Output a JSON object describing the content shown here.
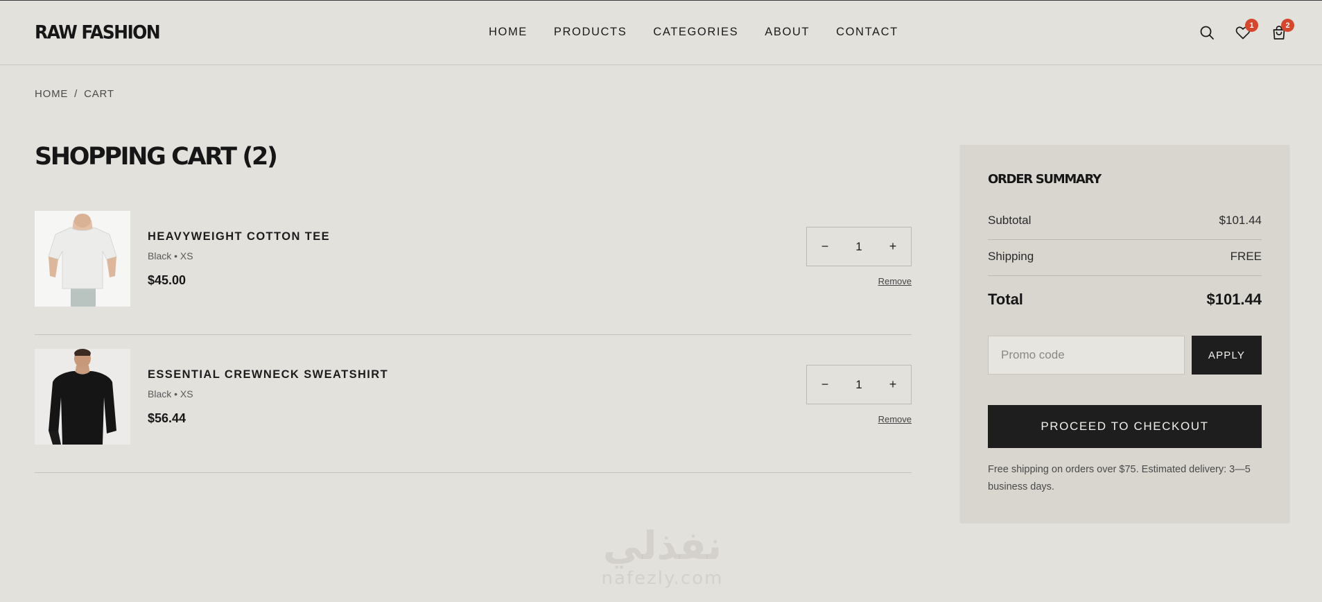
{
  "header": {
    "logo": "RAW FASHION",
    "nav": [
      "HOME",
      "PRODUCTS",
      "CATEGORIES",
      "ABOUT",
      "CONTACT"
    ],
    "icons": {
      "search": "search-icon",
      "wishlist": "heart-icon",
      "cart": "shopping-bag-icon"
    },
    "wishlist_count": "1",
    "cart_count": "2",
    "badge_color": "#d4462d"
  },
  "breadcrumb": {
    "home": "HOME",
    "separator": "/",
    "current": "CART"
  },
  "page_title": "SHOPPING CART (2)",
  "cart": {
    "items": [
      {
        "name": "HEAVYWEIGHT COTTON TEE",
        "variant": "Black • XS",
        "price": "$45.00",
        "quantity": "1",
        "decrement": "−",
        "increment": "+",
        "remove": "Remove",
        "image": "white-tshirt-product-photo"
      },
      {
        "name": "ESSENTIAL CREWNECK SWEATSHIRT",
        "variant": "Black • XS",
        "price": "$56.44",
        "quantity": "1",
        "decrement": "−",
        "increment": "+",
        "remove": "Remove",
        "image": "black-sweatshirt-product-photo"
      }
    ]
  },
  "summary": {
    "title": "ORDER SUMMARY",
    "subtotal_label": "Subtotal",
    "subtotal_value": "$101.44",
    "shipping_label": "Shipping",
    "shipping_value": "FREE",
    "total_label": "Total",
    "total_value": "$101.44",
    "promo_placeholder": "Promo code",
    "apply_label": "APPLY",
    "checkout_label": "PROCEED TO CHECKOUT",
    "note": "Free shipping on orders over $75. Estimated delivery: 3—5 business days."
  },
  "watermark": {
    "arabic": "نفذلي",
    "latin": "nafezly.com"
  }
}
